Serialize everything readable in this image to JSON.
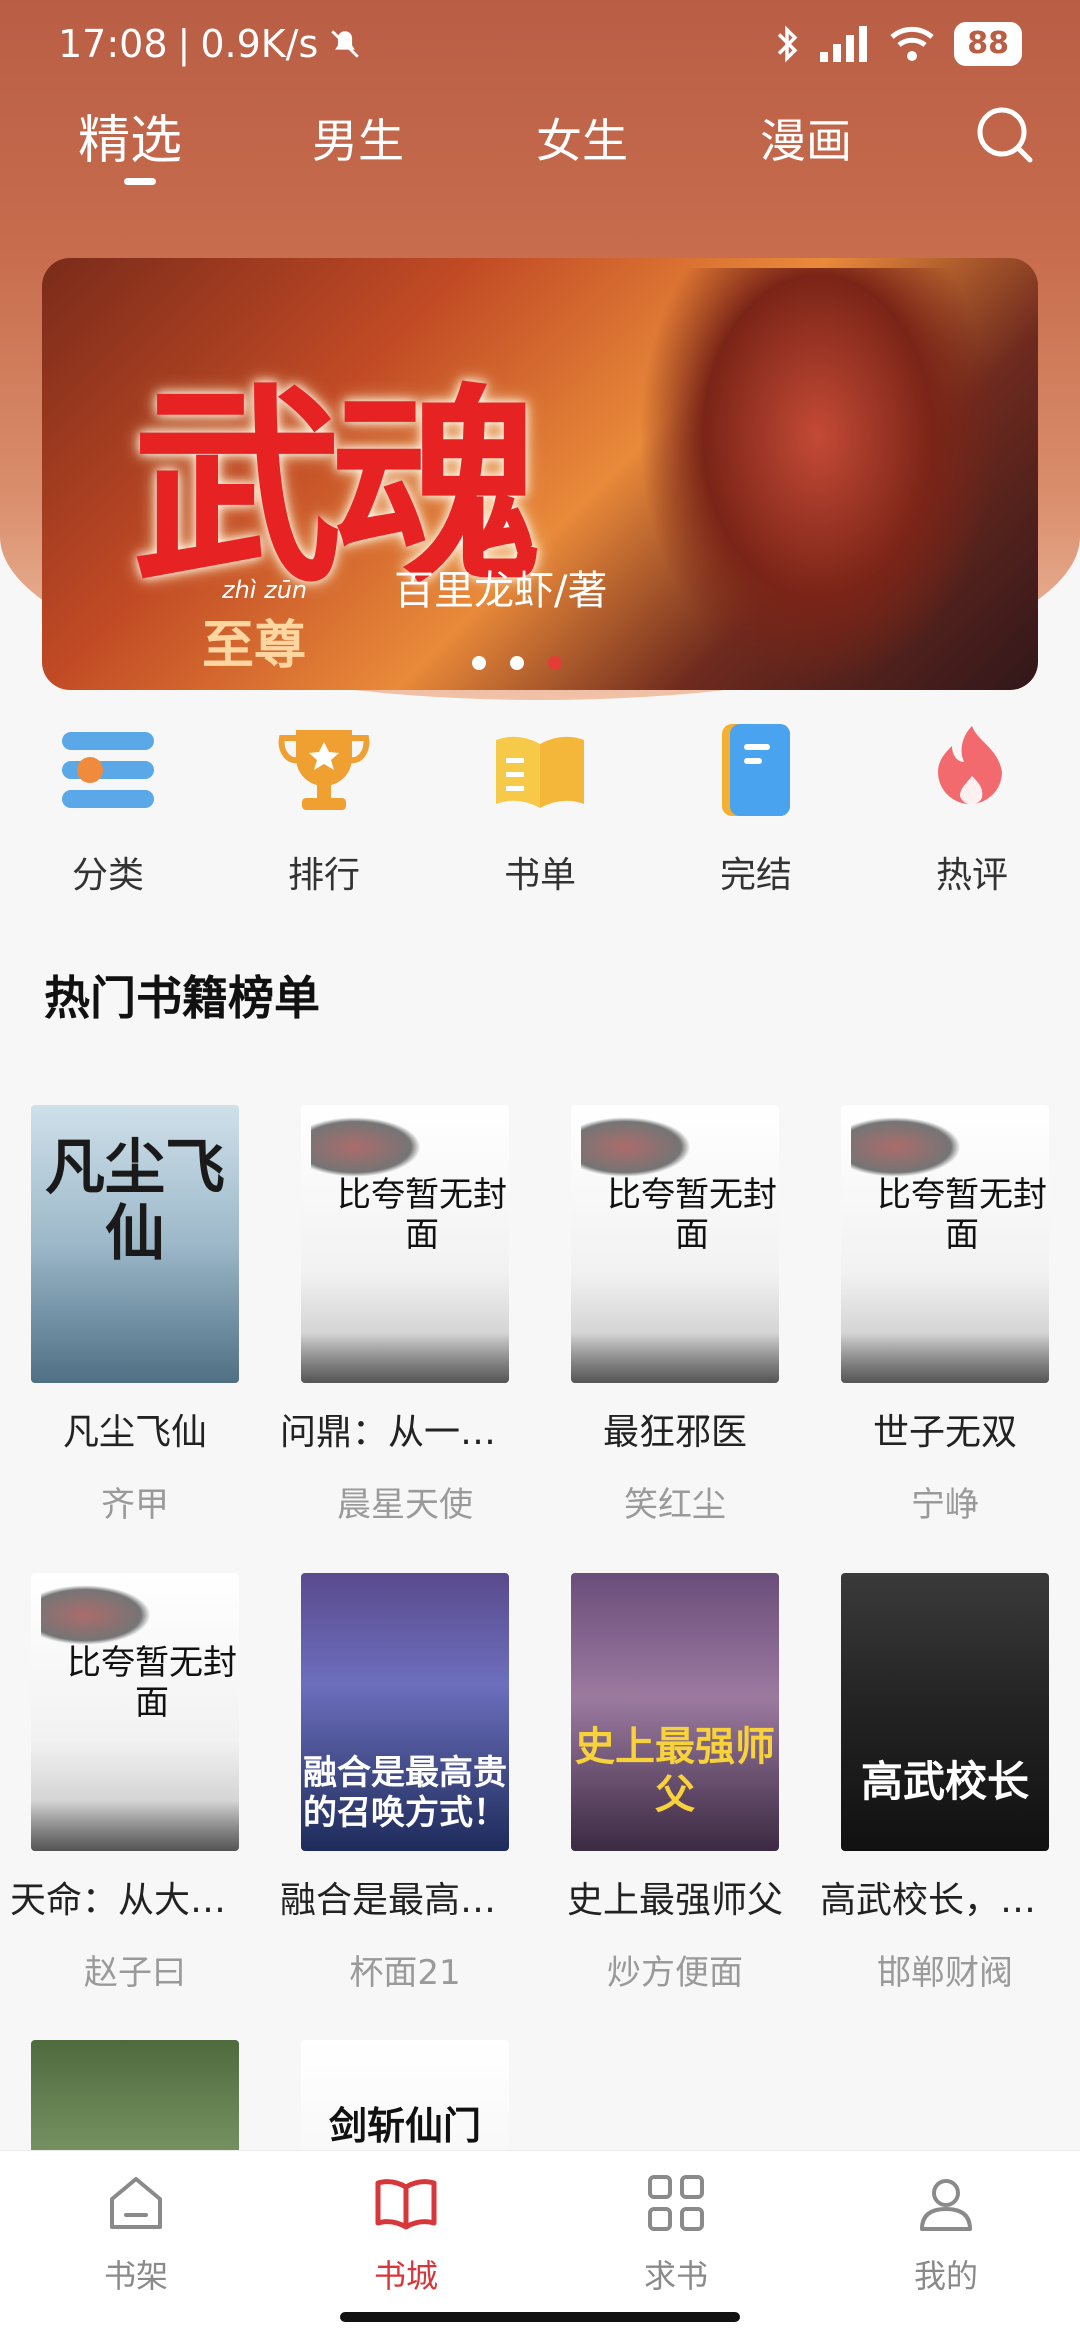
{
  "status": {
    "time": "17:08",
    "speed": "0.9K/s",
    "battery": "88"
  },
  "tabs": [
    {
      "label": "精选"
    },
    {
      "label": "男生"
    },
    {
      "label": "女生"
    },
    {
      "label": "漫画"
    }
  ],
  "banner": {
    "title": "武魂",
    "pinyin": "zhì zūn",
    "subtitle": "至尊",
    "author": "百里龙虾/著"
  },
  "shortcuts": [
    {
      "label": "分类"
    },
    {
      "label": "排行"
    },
    {
      "label": "书单"
    },
    {
      "label": "完结"
    },
    {
      "label": "热评"
    }
  ],
  "section": {
    "title": "热门书籍榜单"
  },
  "books": [
    {
      "title": "凡尘飞仙",
      "author": "齐甲",
      "cover_text": "凡尘飞仙"
    },
    {
      "title": "问鼎：从一等...",
      "author": "晨星天使"
    },
    {
      "title": "最狂邪医",
      "author": "笑红尘"
    },
    {
      "title": "世子无双",
      "author": "宁峥"
    },
    {
      "title": "天命：从大业...",
      "author": "赵子曰"
    },
    {
      "title": "融合是最高贵...",
      "author": "杯面21",
      "cover_text": "融合是最高贵的召唤方式！"
    },
    {
      "title": "史上最强师父",
      "author": "炒方便面",
      "cover_text": "史上最强师父"
    },
    {
      "title": "高武校长，我...",
      "author": "邯郸财阀",
      "cover_text": "高武校长"
    }
  ],
  "partial_books": [
    {
      "cover_text": ""
    },
    {
      "cover_text": "剑斩仙门"
    }
  ],
  "placeholder_cover_text": "比夸暂无封面",
  "bottom_nav": [
    {
      "label": "书架"
    },
    {
      "label": "书城"
    },
    {
      "label": "求书"
    },
    {
      "label": "我的"
    }
  ],
  "colors": {
    "accent": "#d7363a",
    "header": "#c76c4d"
  }
}
